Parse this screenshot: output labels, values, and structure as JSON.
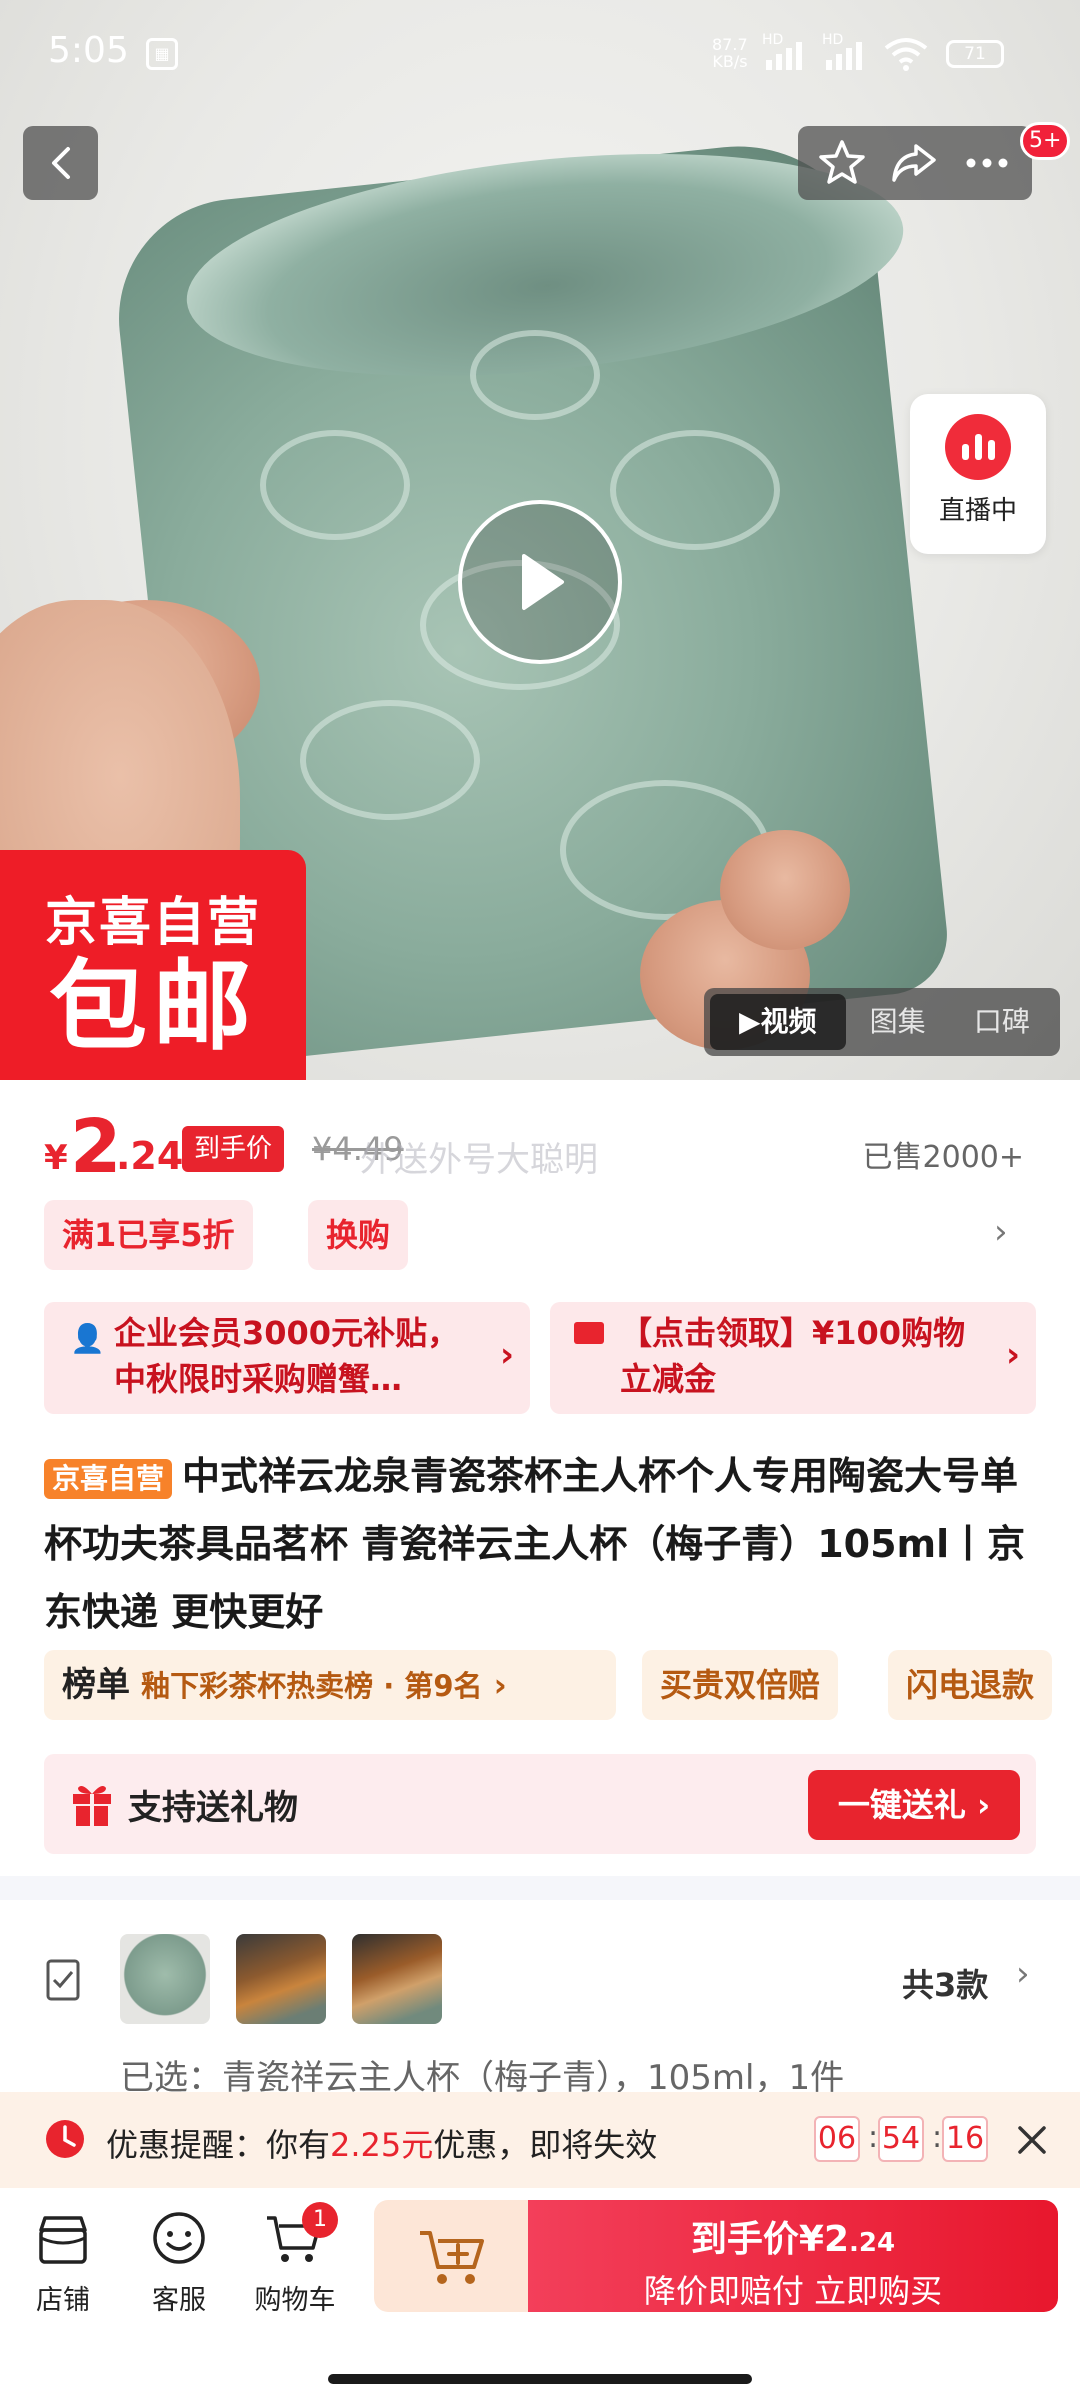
{
  "status_bar": {
    "time": "5:05",
    "net_speed_top": "87.7",
    "net_speed_bottom": "KB/s",
    "battery": "71",
    "hd1": "HD",
    "hd2": "HD"
  },
  "top_actions": {
    "badge": "5+"
  },
  "live": {
    "label": "直播中"
  },
  "promo_banner": {
    "line1": "京喜自营",
    "line2": "包邮"
  },
  "media_tabs": [
    "视频",
    "图集",
    "口碑"
  ],
  "price": {
    "currency": "¥",
    "integer": "2",
    "decimal": ".24",
    "tag": "到手价",
    "original": "¥4.49",
    "watermark": "外送外号大聪明",
    "sold": "已售2000+"
  },
  "chips": [
    "满1已享5折",
    "换购"
  ],
  "coupons": [
    {
      "text": "企业会员3000元补贴，中秋限时采购赠蟹…"
    },
    {
      "text": "【点击领取】¥100购物立减金"
    }
  ],
  "product": {
    "badge": "京喜自营",
    "title": "中式祥云龙泉青瓷茶杯主人杯个人专用陶瓷大号单杯功夫茶具品茗杯 青瓷祥云主人杯（梅子青）105ml丨京东快递 更快更好"
  },
  "rank": {
    "label": "榜单",
    "detail": "釉下彩茶杯热卖榜 · 第9名",
    "tags": [
      "买贵双倍赔",
      "闪电退款"
    ]
  },
  "gift": {
    "label": "支持送礼物",
    "button": "一键送礼"
  },
  "variants": {
    "count": "共3款",
    "selected": "已选：青瓷祥云主人杯（梅子青），105ml，1件"
  },
  "reminder": {
    "prefix": "优惠提醒：你有",
    "amount": "2.25元",
    "suffix": "优惠，即将失效",
    "hours": "06",
    "minutes": "54",
    "seconds": "16"
  },
  "bottom_nav": [
    {
      "label": "店铺",
      "icon": "store-icon"
    },
    {
      "label": "客服",
      "icon": "service-icon"
    },
    {
      "label": "购物车",
      "icon": "cart-icon",
      "badge": "1"
    }
  ],
  "buy": {
    "line1_prefix": "到手价",
    "line1_price": "¥2",
    "line1_decimal": ".24",
    "line2": "降价即赔付 立即购买"
  },
  "colors": {
    "accent": "#e8242e",
    "orange": "#f7822a",
    "pink_bg": "#fde8ea"
  }
}
